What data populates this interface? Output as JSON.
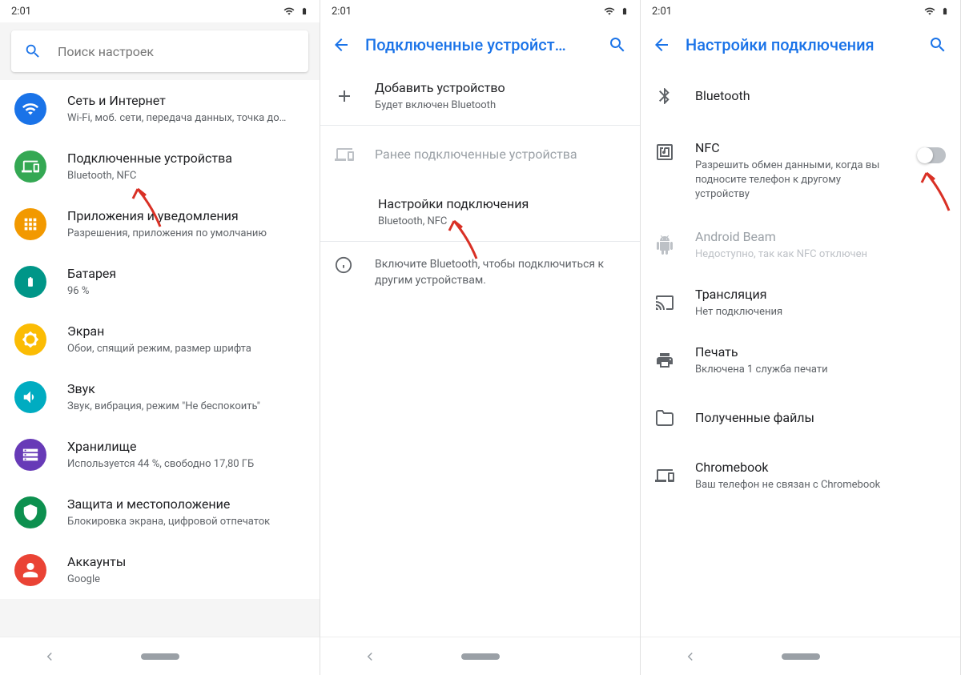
{
  "statusbar": {
    "time": "2:01"
  },
  "screen1": {
    "search_placeholder": "Поиск настроек",
    "items": [
      {
        "title": "Сеть и Интернет",
        "sub": "Wi-Fi, моб. сети, передача данных, точка до…"
      },
      {
        "title": "Подключенные устройства",
        "sub": "Bluetooth, NFC"
      },
      {
        "title": "Приложения и уведомления",
        "sub": "Разрешения, приложения по умолчанию"
      },
      {
        "title": "Батарея",
        "sub": "96 %"
      },
      {
        "title": "Экран",
        "sub": "Обои, спящий режим, размер шрифта"
      },
      {
        "title": "Звук",
        "sub": "Звук, вибрация, режим \"Не беспокоить\""
      },
      {
        "title": "Хранилище",
        "sub": "Используется 44 %, свободно 17,80 ГБ"
      },
      {
        "title": "Защита и местоположение",
        "sub": "Блокировка экрана, цифровой отпечаток"
      },
      {
        "title": "Аккаунты",
        "sub": "Google"
      }
    ]
  },
  "screen2": {
    "title": "Подключенные устройст…",
    "add_pair": {
      "title": "Добавить устройство",
      "sub": "Будет включен Bluetooth"
    },
    "prev_header": "Ранее подключенные устройства",
    "conn_prefs": {
      "title": "Настройки подключения",
      "sub": "Bluetooth, NFC"
    },
    "info": "Включите Bluetooth, чтобы подключиться к другим устройствам."
  },
  "screen3": {
    "title": "Настройки подключения",
    "items": {
      "bluetooth": {
        "title": "Bluetooth"
      },
      "nfc": {
        "title": "NFC",
        "sub": "Разрешить обмен данными, когда вы подносите телефон к другому устройству"
      },
      "beam": {
        "title": "Android Beam",
        "sub": "Недоступно, так как NFC отключен"
      },
      "cast": {
        "title": "Трансляция",
        "sub": "Нет подключения"
      },
      "print": {
        "title": "Печать",
        "sub": "Включена 1 служба печати"
      },
      "files": {
        "title": "Полученные файлы"
      },
      "chromebook": {
        "title": "Chromebook",
        "sub": "Ваш телефон не связан с Chromebook"
      }
    }
  }
}
